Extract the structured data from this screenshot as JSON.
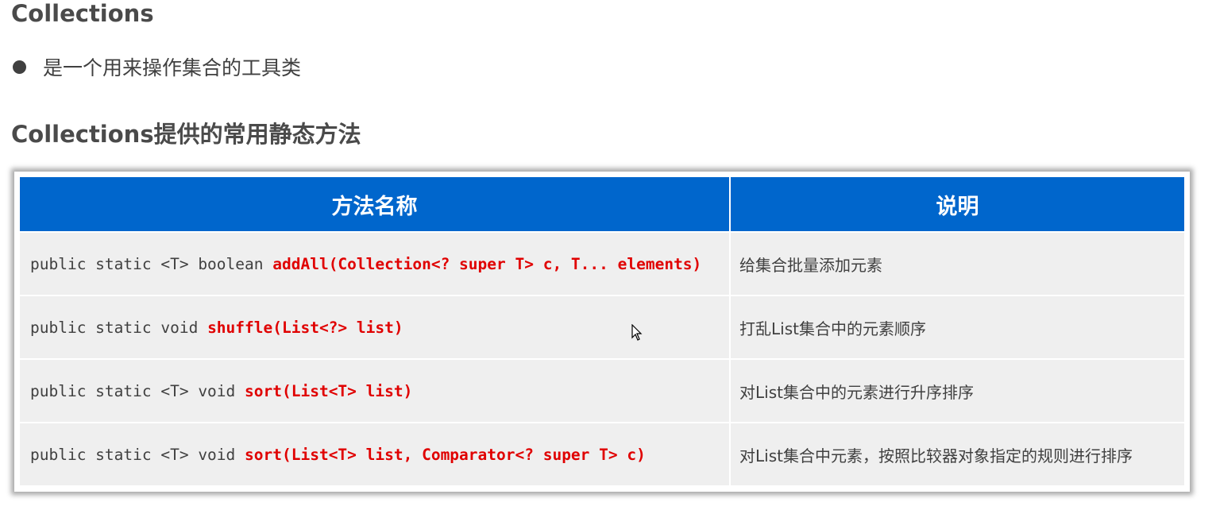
{
  "title": "Collections",
  "bullet": "是一个用来操作集合的工具类",
  "subtitle": "Collections提供的常用静态方法",
  "table": {
    "headers": [
      "方法名称",
      "说明"
    ],
    "rows": [
      {
        "prefix": "public static <T> boolean ",
        "method": "addAll(Collection<? super T> c, T... elements)",
        "desc": "给集合批量添加元素"
      },
      {
        "prefix": "public static void ",
        "method": "shuffle(List<?> list)",
        "desc": "打乱List集合中的元素顺序"
      },
      {
        "prefix": "public static <T> void ",
        "method": "sort(List<T> list)",
        "desc": "对List集合中的元素进行升序排序"
      },
      {
        "prefix": "public static <T> void ",
        "method": "sort(List<T> list, Comparator<? super T> c)",
        "desc": "对List集合中元素，按照比较器对象指定的规则进行排序"
      }
    ]
  },
  "colors": {
    "header": "#0066cc",
    "method": "#e00000",
    "row": "#efefef"
  }
}
